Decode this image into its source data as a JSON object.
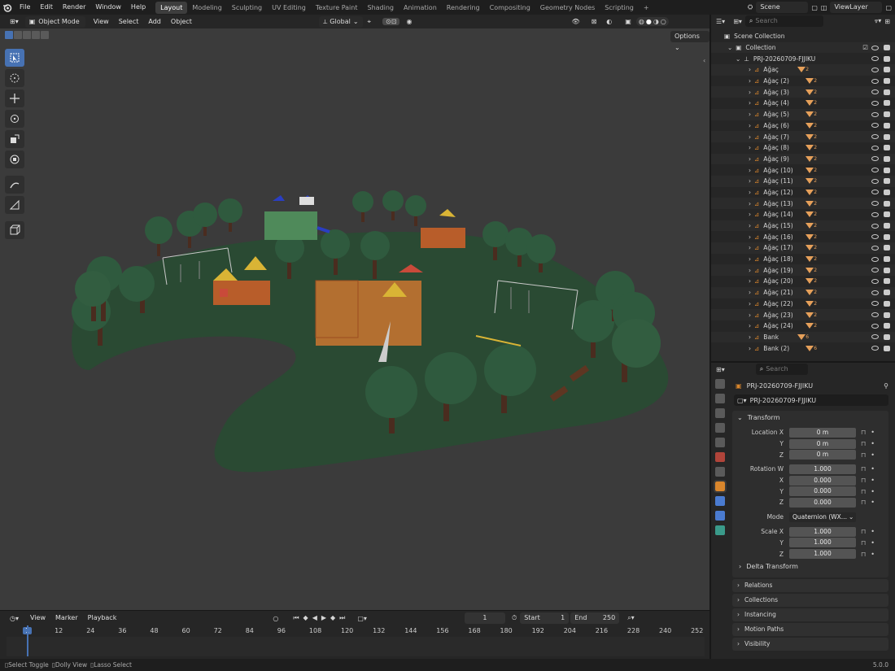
{
  "topbar": {
    "menus": [
      "File",
      "Edit",
      "Render",
      "Window",
      "Help"
    ],
    "workspaces": [
      "Layout",
      "Modeling",
      "Sculpting",
      "UV Editing",
      "Texture Paint",
      "Shading",
      "Animation",
      "Rendering",
      "Compositing",
      "Geometry Nodes",
      "Scripting"
    ],
    "active_workspace": "Layout",
    "add_tab": "+",
    "scene": "Scene",
    "view_layer": "ViewLayer"
  },
  "viewport_header": {
    "mode": "Object Mode",
    "menus": [
      "View",
      "Select",
      "Add",
      "Object"
    ],
    "orientation": "Global",
    "options": "Options"
  },
  "timeline": {
    "menus": [
      "View",
      "Marker",
      "Playback"
    ],
    "current_frame": "1",
    "start_label": "Start",
    "start": "1",
    "end_label": "End",
    "end": "250",
    "ticks": [
      "1",
      "12",
      "24",
      "36",
      "48",
      "60",
      "72",
      "84",
      "96",
      "108",
      "120",
      "132",
      "144",
      "156",
      "168",
      "180",
      "192",
      "204",
      "216",
      "228",
      "240",
      "252"
    ]
  },
  "status": {
    "select_toggle": "Select Toggle",
    "dolly_view": "Dolly View",
    "lasso_select": "Lasso Select",
    "version": "5.0.0"
  },
  "outliner": {
    "search_placeholder": "Search",
    "scene_collection": "Scene Collection",
    "collection": "Collection",
    "project": "PRJ-20260709-FJJIKU",
    "items": [
      {
        "name": "Ağaç",
        "sub": "2"
      },
      {
        "name": "Ağaç (2)",
        "sub": "2"
      },
      {
        "name": "Ağaç (3)",
        "sub": "2"
      },
      {
        "name": "Ağaç (4)",
        "sub": "2"
      },
      {
        "name": "Ağaç (5)",
        "sub": "2"
      },
      {
        "name": "Ağaç (6)",
        "sub": "2"
      },
      {
        "name": "Ağaç (7)",
        "sub": "2"
      },
      {
        "name": "Ağaç (8)",
        "sub": "2"
      },
      {
        "name": "Ağaç (9)",
        "sub": "2"
      },
      {
        "name": "Ağaç (10)",
        "sub": "2"
      },
      {
        "name": "Ağaç (11)",
        "sub": "2"
      },
      {
        "name": "Ağaç (12)",
        "sub": "2"
      },
      {
        "name": "Ağaç (13)",
        "sub": "2"
      },
      {
        "name": "Ağaç (14)",
        "sub": "2"
      },
      {
        "name": "Ağaç (15)",
        "sub": "2"
      },
      {
        "name": "Ağaç (16)",
        "sub": "2"
      },
      {
        "name": "Ağaç (17)",
        "sub": "2"
      },
      {
        "name": "Ağaç (18)",
        "sub": "2"
      },
      {
        "name": "Ağaç (19)",
        "sub": "2"
      },
      {
        "name": "Ağaç (20)",
        "sub": "2"
      },
      {
        "name": "Ağaç (21)",
        "sub": "2"
      },
      {
        "name": "Ağaç (22)",
        "sub": "2"
      },
      {
        "name": "Ağaç (23)",
        "sub": "2"
      },
      {
        "name": "Ağaç (24)",
        "sub": "2"
      },
      {
        "name": "Bank",
        "sub": "6"
      },
      {
        "name": "Bank (2)",
        "sub": "6"
      }
    ]
  },
  "properties": {
    "search_placeholder": "Search",
    "object_name": "PRJ-20260709-FJJIKU",
    "data_name": "PRJ-20260709-FJJIKU",
    "transform_label": "Transform",
    "location": {
      "label": "Location X",
      "x": "0 m",
      "y": "0 m",
      "z": "0 m"
    },
    "rotation": {
      "label": "Rotation W",
      "w": "1.000",
      "x": "0.000",
      "y": "0.000",
      "z": "0.000"
    },
    "mode_label": "Mode",
    "mode": "Quaternion (WX...",
    "scale": {
      "label": "Scale X",
      "x": "1.000",
      "y": "1.000",
      "z": "1.000"
    },
    "axis": {
      "x": "X",
      "y": "Y",
      "z": "Z"
    },
    "panels": [
      "Delta Transform",
      "Relations",
      "Collections",
      "Instancing",
      "Motion Paths",
      "Visibility"
    ]
  },
  "colors": {
    "accent": "#4772b3",
    "grass": "#2a4a33",
    "tree": "#2f5a3e",
    "trunk": "#4a2c1f",
    "frame_marker": "#4772b3"
  }
}
